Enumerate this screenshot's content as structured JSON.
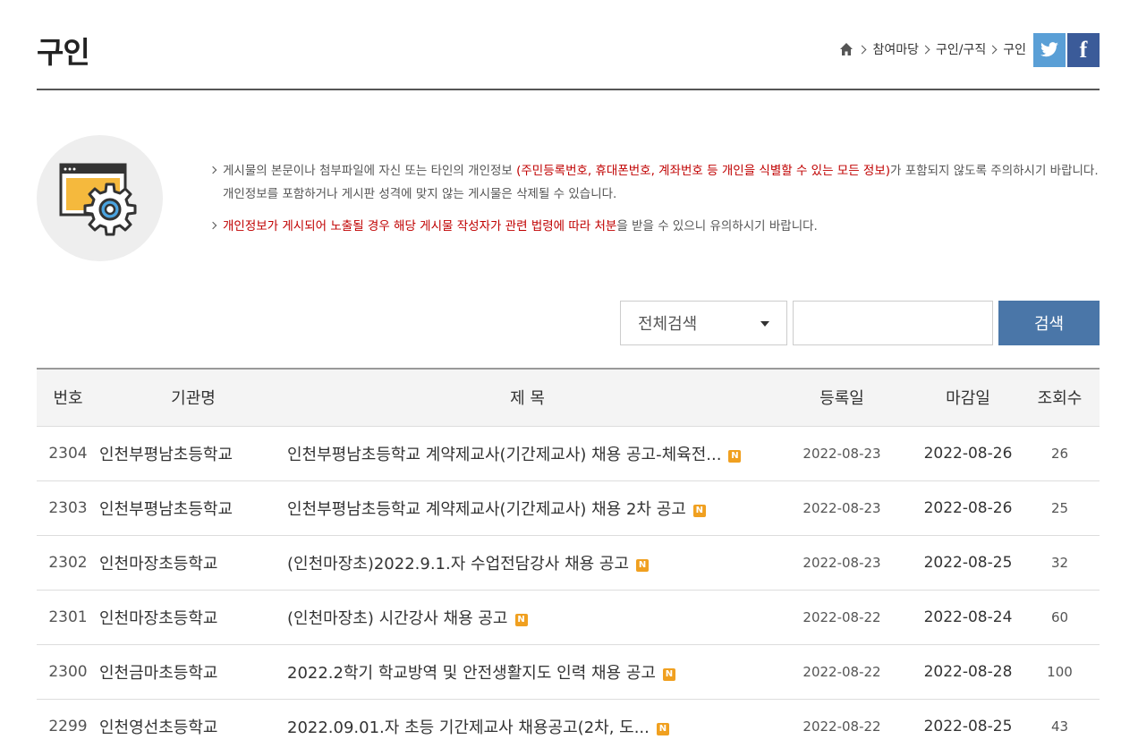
{
  "page": {
    "title": "구인"
  },
  "breadcrumb": {
    "items": [
      "참여마당",
      "구인/구직",
      "구인"
    ]
  },
  "share": {
    "twitter": "twitter-icon",
    "facebook_label": "f"
  },
  "notice": {
    "line1_a": "게시물의 본문이나 첨부파일에 자신 또는 타인의 개인정보 ",
    "line1_red": "(주민등록번호, 휴대폰번호, 계좌번호 등 개인을 식별할 수 있는 모든 정보)",
    "line1_b": "가 포함되지 않도록 주의하시기 바랍니다. 개인정보를 포함하거나 게시판 성격에 맞지 않는 게시물은 삭제될 수 있습니다.",
    "line2_red": "개인정보가 게시되어 노출될 경우 해당 게시물 작성자가 관련 법령에 따라 처분",
    "line2_b": "을 받을 수 있으니 유의하시기 바랍니다."
  },
  "search": {
    "select_value": "전체검색",
    "input_value": "",
    "button_label": "검색"
  },
  "table": {
    "headers": [
      "번호",
      "기관명",
      "제 목",
      "등록일",
      "마감일",
      "조회수"
    ],
    "badge": "N",
    "rows": [
      {
        "num": "2304",
        "org": "인천부평남초등학교",
        "title": "인천부평남초등학교 계약제교사(기간제교사) 채용 공고-체육전...",
        "reg": "2022-08-23",
        "due": "2022-08-26",
        "views": "26"
      },
      {
        "num": "2303",
        "org": "인천부평남초등학교",
        "title": "인천부평남초등학교 계약제교사(기간제교사) 채용 2차 공고",
        "reg": "2022-08-23",
        "due": "2022-08-26",
        "views": "25"
      },
      {
        "num": "2302",
        "org": "인천마장초등학교",
        "title": "(인천마장초)2022.9.1.자 수업전담강사 채용 공고",
        "reg": "2022-08-23",
        "due": "2022-08-25",
        "views": "32"
      },
      {
        "num": "2301",
        "org": "인천마장초등학교",
        "title": "(인천마장초) 시간강사 채용 공고",
        "reg": "2022-08-22",
        "due": "2022-08-24",
        "views": "60"
      },
      {
        "num": "2300",
        "org": "인천금마초등학교",
        "title": "2022.2학기 학교방역 및 안전생활지도 인력 채용 공고",
        "reg": "2022-08-22",
        "due": "2022-08-28",
        "views": "100"
      },
      {
        "num": "2299",
        "org": "인천영선초등학교",
        "title": "2022.09.01.자 초등 기간제교사 채용공고(2차, 도...",
        "reg": "2022-08-22",
        "due": "2022-08-25",
        "views": "43"
      }
    ]
  }
}
